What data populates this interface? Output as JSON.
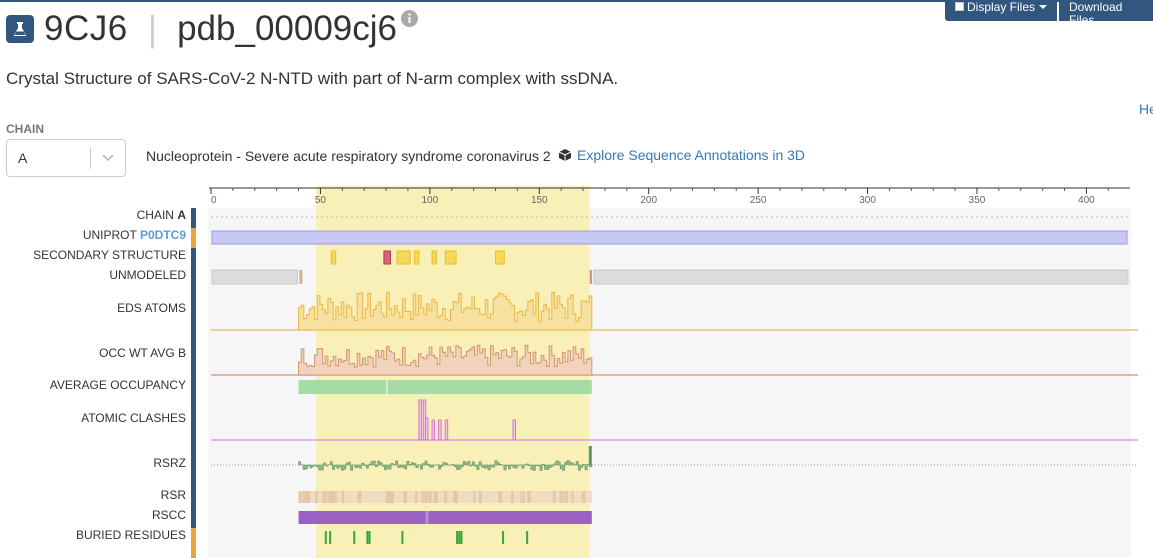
{
  "header": {
    "entry_id": "9CJ6",
    "extended_id": "pdb_00009cj6",
    "description": "Crystal Structure of SARS-CoV-2 N-NTD with part of N-arm complex with ssDNA.",
    "help_link": "He"
  },
  "buttons": {
    "display_files": "Display Files",
    "download_files": "Download Files"
  },
  "chain_selector": {
    "label": "CHAIN",
    "value": "A"
  },
  "entity": {
    "name": "Nucleoprotein - Severe acute respiratory syndrome coronavirus 2",
    "explore_link": "Explore Sequence Annotations in 3D"
  },
  "axis": {
    "ticks": [
      "0",
      "50",
      "100",
      "150",
      "200",
      "250",
      "300",
      "350",
      "400"
    ]
  },
  "tracks": {
    "chain": {
      "label": "CHAIN",
      "value": "A"
    },
    "uniprot": {
      "label": "UNIPROT",
      "accession": "P0DTC9"
    },
    "secondary_structure": {
      "label": "SECONDARY STRUCTURE"
    },
    "unmodeled": {
      "label": "UNMODELED"
    },
    "eds_atoms": {
      "label": "EDS ATOMS"
    },
    "occ_wt_avg_b": {
      "label": "OCC WT AVG B"
    },
    "average_occupancy": {
      "label": "AVERAGE OCCUPANCY"
    },
    "atomic_clashes": {
      "label": "ATOMIC CLASHES"
    },
    "rsrz": {
      "label": "RSRZ"
    },
    "rsr": {
      "label": "RSR"
    },
    "rscc": {
      "label": "RSCC"
    },
    "buried_residues": {
      "label": "BURIED RESIDUES"
    }
  },
  "sequence": {
    "length": 419,
    "highlight_range": [
      48,
      173
    ],
    "modeled_range": [
      40,
      174
    ]
  },
  "colors": {
    "brand": "#31577f",
    "link": "#337ab7",
    "uniprot_accent": "#5aa0d6",
    "highlight": "#f9f0b8",
    "uniprot_bar": "#c8c8f5",
    "helix": "#f5d855",
    "helix_red": "#e0607a",
    "unmodeled": "#dcdcdc",
    "eds": "#f3d27a",
    "occ": "#e2b89a",
    "avg_occ": "#a4dca4",
    "clash": "#e9a6dd",
    "rsr": "#f0dcc0",
    "rscc": "#9b62c6",
    "buried": "#3aa63a",
    "side_orange": "#e8a33d",
    "side_navy": "#31577f"
  },
  "icons": {
    "title_icon": "flask-icon",
    "info": "info-icon",
    "explore": "cube-icon",
    "dropdown": "chevron-down-icon"
  }
}
